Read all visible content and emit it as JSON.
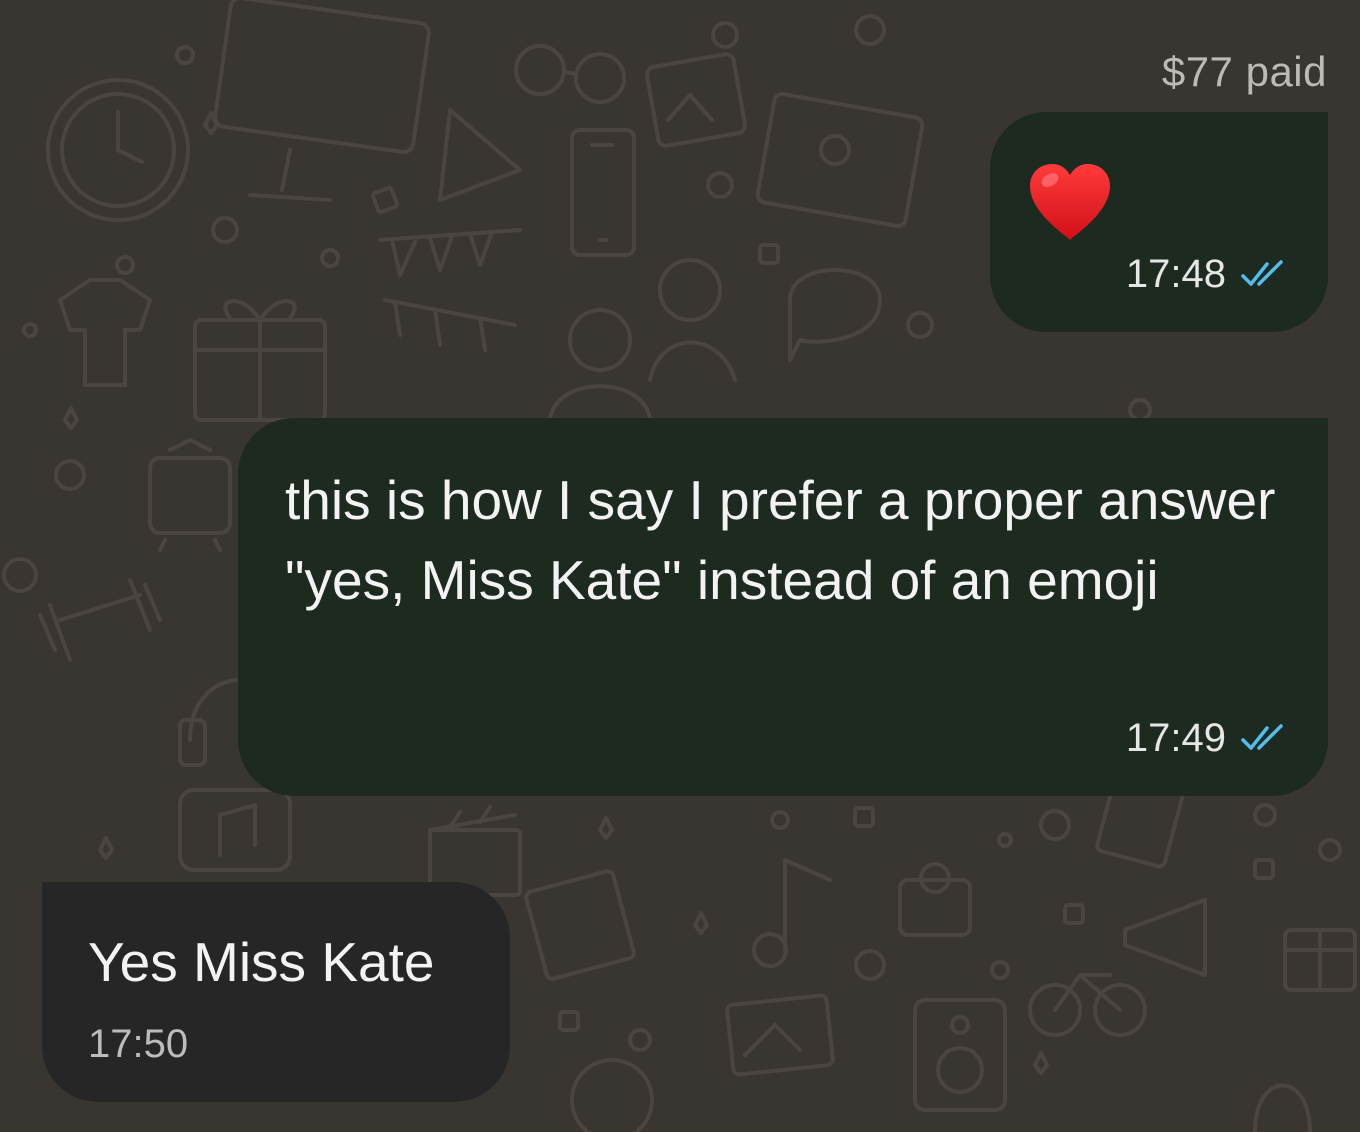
{
  "header": {
    "payment_label": "$77 paid"
  },
  "messages": [
    {
      "direction": "outgoing",
      "content_icon": "red-heart-icon",
      "time": "17:48",
      "status": "read",
      "status_icon": "double-check-icon"
    },
    {
      "direction": "outgoing",
      "text": "this is how I say I prefer a proper answer \"yes, Miss Kate\" instead of an emoji",
      "time": "17:49",
      "status": "read",
      "status_icon": "double-check-icon"
    },
    {
      "direction": "incoming",
      "text": "Yes Miss Kate",
      "time": "17:50"
    }
  ],
  "colors": {
    "background": "#393531",
    "outgoing_bubble": "#1d2a20",
    "incoming_bubble": "#262626",
    "read_ticks": "#53bdeb",
    "heart": "#e0161d"
  }
}
